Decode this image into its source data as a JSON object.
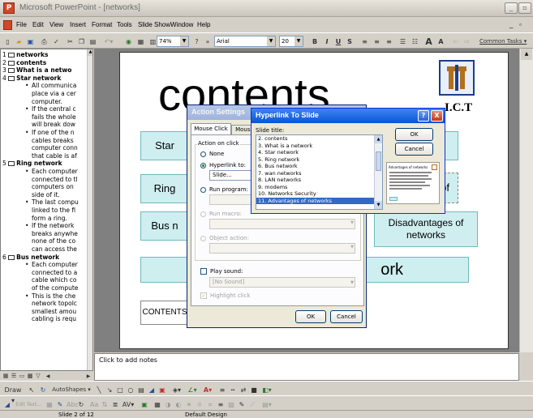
{
  "window": {
    "title": "Microsoft PowerPoint - [networks]"
  },
  "menu": [
    "File",
    "Edit",
    "View",
    "Insert",
    "Format",
    "Tools",
    "Slide Show",
    "Window",
    "Help"
  ],
  "toolbar": {
    "zoom": "74%",
    "font": "Arial",
    "font_size": "20",
    "bold": "B",
    "italic": "I",
    "underline": "U",
    "shadow": "S",
    "common_tasks": "Common Tasks"
  },
  "outline": [
    {
      "n": "1",
      "text": "networks",
      "type": "slide"
    },
    {
      "n": "2",
      "text": "contents",
      "type": "slide"
    },
    {
      "n": "3",
      "text": "What is a netwo",
      "type": "slide"
    },
    {
      "n": "4",
      "text": "Star network",
      "type": "slide"
    },
    {
      "text": "All communica",
      "type": "bullet"
    },
    {
      "text": "place via a cer",
      "type": "cont"
    },
    {
      "text": "computer.",
      "type": "cont"
    },
    {
      "text": "If the central c",
      "type": "bullet"
    },
    {
      "text": "fails the whole",
      "type": "cont"
    },
    {
      "text": "will break dow",
      "type": "cont"
    },
    {
      "text": "If one of the n",
      "type": "bullet"
    },
    {
      "text": "cables breaks",
      "type": "cont"
    },
    {
      "text": "computer conn",
      "type": "cont"
    },
    {
      "text": "that cable is af",
      "type": "cont"
    },
    {
      "n": "5",
      "text": "Ring network",
      "type": "slide"
    },
    {
      "text": "Each computer",
      "type": "bullet"
    },
    {
      "text": "connected to tl",
      "type": "cont"
    },
    {
      "text": "computers on",
      "type": "cont"
    },
    {
      "text": "side of it.",
      "type": "cont"
    },
    {
      "text": "The last compu",
      "type": "bullet"
    },
    {
      "text": "linked to the fi",
      "type": "cont"
    },
    {
      "text": "form a ring.",
      "type": "cont"
    },
    {
      "text": "If the network",
      "type": "bullet"
    },
    {
      "text": "breaks anywhe",
      "type": "cont"
    },
    {
      "text": "none of the co",
      "type": "cont"
    },
    {
      "text": "can access the",
      "type": "cont"
    },
    {
      "n": "6",
      "text": "Bus network",
      "type": "slide"
    },
    {
      "text": "Each computer",
      "type": "bullet"
    },
    {
      "text": "connected to a",
      "type": "cont"
    },
    {
      "text": "cable which co",
      "type": "cont"
    },
    {
      "text": "of the compute",
      "type": "cont"
    },
    {
      "text": "This is the che",
      "type": "bullet"
    },
    {
      "text": "network topolc",
      "type": "cont"
    },
    {
      "text": "smallest amou",
      "type": "cont"
    },
    {
      "text": "cabling is requ",
      "type": "cont"
    }
  ],
  "slide": {
    "title": "contents",
    "logo_text": "I.C.T",
    "btn_star": "Star",
    "btn_ring": "Ring",
    "btn_bus": "Bus n",
    "btn_of": "of",
    "btn_disadv": "Disadvantages of networks",
    "btn_work": "ork",
    "btn_contents": "CONTENTS"
  },
  "notes": {
    "placeholder": "Click to add notes"
  },
  "action_settings": {
    "title": "Action Settings",
    "tab1": "Mouse Click",
    "tab2": "Mouse C",
    "group": "Action on click",
    "none": "None",
    "hyperlink": "Hyperlink to:",
    "hyperlink_value": "Slide...",
    "run_program": "Run program:",
    "run_macro": "Run macro:",
    "object_action": "Object action:",
    "play_sound": "Play sound:",
    "sound_value": "[No Sound]",
    "highlight": "Highlight click",
    "ok": "OK",
    "cancel": "Cancel"
  },
  "hyperlink_dialog": {
    "title": "Hyperlink To Slide",
    "help": "?",
    "close": "X",
    "slide_title_label": "Slide title:",
    "items": [
      "2. contents",
      "3. What is a network",
      "4. Star network",
      "5. Ring network",
      "6. Bus network",
      "7. wan networks",
      "8. LAN networks",
      "9. modems",
      "10. Networks Security",
      "11. Advantages of networks"
    ],
    "selected_index": 9,
    "ok": "OK",
    "cancel": "Cancel",
    "preview_title": "Advantages of networks"
  },
  "drawing": {
    "draw": "Draw",
    "autoshapes": "AutoShapes"
  },
  "toolbar3": {
    "edit_text": "Edit Text..."
  },
  "status": {
    "slide": "Slide 2 of 12",
    "design": "Default Design"
  }
}
